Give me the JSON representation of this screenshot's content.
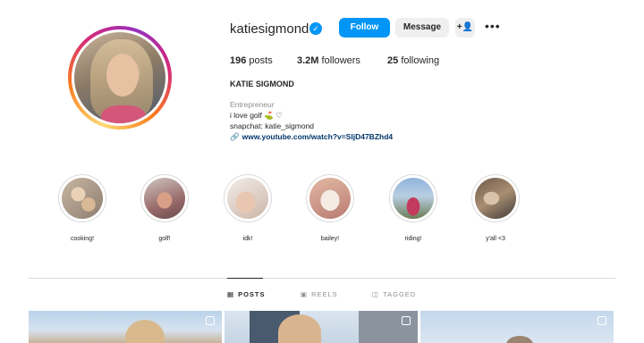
{
  "profile": {
    "username": "katiesigmond",
    "verified_icon": "verified-badge-icon",
    "follow_label": "Follow",
    "message_label": "Message",
    "suggest_icon": "add-person-icon",
    "more_icon": "more-options-icon",
    "more_glyph": "•••",
    "suggest_glyph": "+👤",
    "stats": {
      "posts_count": "196",
      "posts_label": "posts",
      "followers_count": "3.2M",
      "followers_label": "followers",
      "following_count": "25",
      "following_label": "following"
    },
    "full_name": "KATIE SIGMOND",
    "category": "Entrepreneur",
    "bio_lines": [
      "i love golf ⛳ ♡",
      "snapchat: katie_sigmond"
    ],
    "link": "www.youtube.com/watch?v=SljD47BZhd4",
    "link_icon_glyph": "🔗"
  },
  "highlights": [
    {
      "label": "cooking!"
    },
    {
      "label": "golf!"
    },
    {
      "label": "idk!"
    },
    {
      "label": "bailey!"
    },
    {
      "label": "riding!"
    },
    {
      "label": "y'all <3"
    }
  ],
  "tabs": [
    {
      "label": "POSTS",
      "icon": "grid-icon",
      "glyph": "▦",
      "active": true
    },
    {
      "label": "REELS",
      "icon": "reels-icon",
      "glyph": "▣",
      "active": false
    },
    {
      "label": "TAGGED",
      "icon": "tagged-icon",
      "glyph": "◫",
      "active": false
    }
  ],
  "colors": {
    "accent": "#0095f6",
    "ring": [
      "#feda75",
      "#fa7e1e",
      "#d62976",
      "#962fbf"
    ]
  }
}
